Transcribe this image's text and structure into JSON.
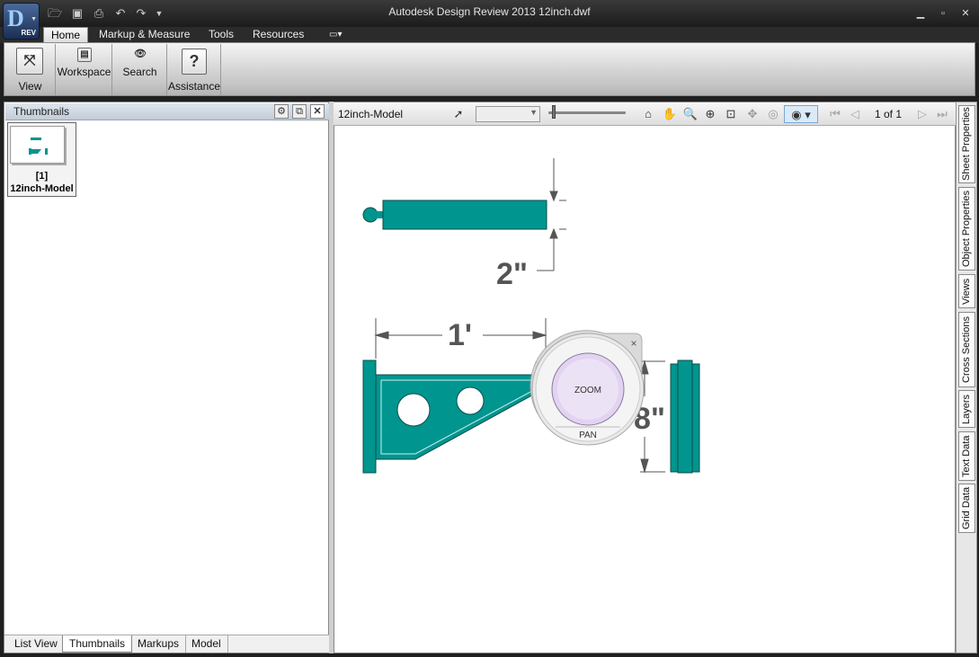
{
  "window": {
    "title": "Autodesk Design Review 2013     12inch.dwf",
    "app_badge": "REV",
    "app_letter": "D"
  },
  "quick_access": [
    "folder-open-icon",
    "save-icon",
    "print-icon",
    "undo-icon",
    "redo-icon",
    "customize-dropdown-icon"
  ],
  "ribbon_tabs": [
    {
      "label": "Home",
      "active": true
    },
    {
      "label": "Markup & Measure",
      "active": false
    },
    {
      "label": "Tools",
      "active": false
    },
    {
      "label": "Resources",
      "active": false
    }
  ],
  "ribbon": {
    "view": "View",
    "workspace": "Workspace",
    "search": "Search",
    "assistance": "Assistance"
  },
  "left_pane": {
    "header": "Thumbnails",
    "thumbnail": {
      "index": "[1]",
      "name": "12inch-Model"
    },
    "bottom_tabs": [
      {
        "label": "List View",
        "active": false
      },
      {
        "label": "Thumbnails",
        "active": true
      },
      {
        "label": "Markups",
        "active": false
      },
      {
        "label": "Model",
        "active": false
      }
    ]
  },
  "viewer": {
    "sheet_title": "12inch-Model",
    "zoom_value": "",
    "page_indicator": "1 of 1"
  },
  "right_tabs": [
    "Sheet Properties",
    "Object Properties",
    "Views",
    "Cross Sections",
    "Layers",
    "Text Data",
    "Grid Data"
  ],
  "drawing": {
    "dim_top": "2\"",
    "dim_width": "1'",
    "dim_height": "8\"",
    "wheel_zoom": "ZOOM",
    "wheel_pan": "PAN",
    "wheel_close": "×"
  },
  "colors": {
    "part_teal": "#00958f",
    "part_outline": "#0a4d4a",
    "dimension": "#555555"
  }
}
